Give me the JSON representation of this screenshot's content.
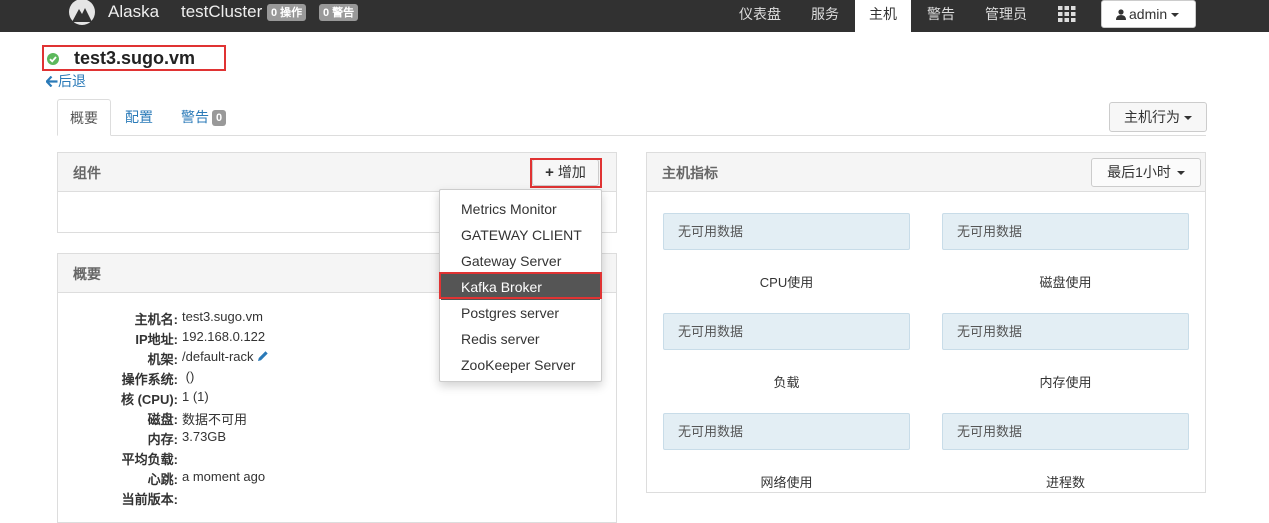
{
  "navbar": {
    "brand": "Alaska",
    "cluster": "testCluster",
    "ops_badge": "0 操作",
    "alerts_badge": "0 警告",
    "items": [
      {
        "label": "仪表盘"
      },
      {
        "label": "服务"
      },
      {
        "label": "主机"
      },
      {
        "label": "警告"
      },
      {
        "label": "管理员"
      }
    ],
    "user": "admin",
    "active": "主机"
  },
  "host": {
    "title": "test3.sugo.vm",
    "status_icon": "check-circle-icon",
    "back_label": "后退"
  },
  "tabs": [
    {
      "label": "概要"
    },
    {
      "label": "配置"
    },
    {
      "label": "警告"
    }
  ],
  "alerts_tab_count": "0",
  "host_actions_label": "主机行为",
  "components": {
    "title": "组件",
    "add_label": "增加",
    "dropdown": [
      "Metrics Monitor",
      "GATEWAY CLIENT",
      "Gateway Server",
      "Kafka Broker",
      "Postgres server",
      "Redis server",
      "ZooKeeper Server"
    ],
    "highlighted": "Kafka Broker"
  },
  "summary": {
    "title": "概要",
    "rows": [
      {
        "label": "主机名:",
        "value": "test3.sugo.vm"
      },
      {
        "label": "IP地址:",
        "value": "192.168.0.122"
      },
      {
        "label": "机架:",
        "value": "/default-rack"
      },
      {
        "label": "操作系统:",
        "value": " ()"
      },
      {
        "label": "核 (CPU):",
        "value": "1 (1)"
      },
      {
        "label": "磁盘:",
        "value": "数据不可用"
      },
      {
        "label": "内存:",
        "value": "3.73GB"
      },
      {
        "label": "平均负载:",
        "value": ""
      },
      {
        "label": "心跳:",
        "value": "a moment ago"
      },
      {
        "label": "当前版本:",
        "value": ""
      }
    ]
  },
  "metrics": {
    "title": "主机指标",
    "range_label": "最后1小时",
    "no_data": "无可用数据",
    "cards": [
      {
        "label": "CPU使用"
      },
      {
        "label": "磁盘使用"
      },
      {
        "label": "负载"
      },
      {
        "label": "内存使用"
      },
      {
        "label": "网络使用"
      },
      {
        "label": "进程数"
      }
    ]
  },
  "colors": {
    "navbar": "#313131",
    "link": "#2a7ab8",
    "highlight_box": "#e03333",
    "status_ok": "#5cb85c"
  }
}
